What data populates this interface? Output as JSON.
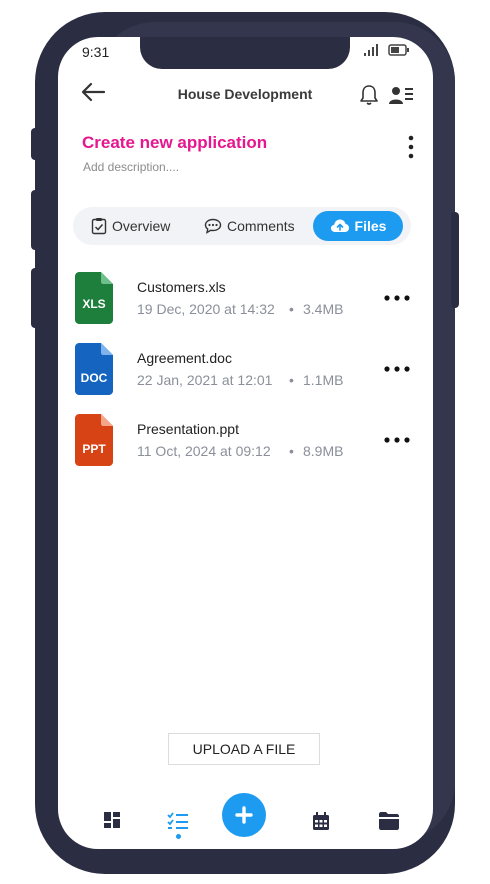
{
  "status": {
    "time": "9:31"
  },
  "header": {
    "title": "House Development"
  },
  "application": {
    "title": "Create new application",
    "description_placeholder": "Add description...."
  },
  "tabs": [
    {
      "label": "Overview",
      "icon": "clipboard-check-icon"
    },
    {
      "label": "Comments",
      "icon": "comment-dots-icon"
    },
    {
      "label": "Files",
      "icon": "cloud-upload-icon",
      "active": true
    }
  ],
  "files": [
    {
      "name": "Customers.xls",
      "date": "19 Dec, 2020 at 14:32",
      "size": "3.4MB",
      "type": "XLS",
      "color": "#1e7f3c"
    },
    {
      "name": "Agreement.doc",
      "date": "22 Jan, 2021 at 12:01",
      "size": "1.1MB",
      "type": "DOC",
      "color": "#1565c0"
    },
    {
      "name": "Presentation.ppt",
      "date": "11 Oct, 2024 at 09:12",
      "size": "8.9MB",
      "type": "PPT",
      "color": "#d84315"
    }
  ],
  "upload": {
    "label": "UPLOAD A FILE"
  },
  "colors": {
    "accent": "#1c9bf0",
    "title": "#e6168e",
    "frame": "#2b2d42"
  }
}
